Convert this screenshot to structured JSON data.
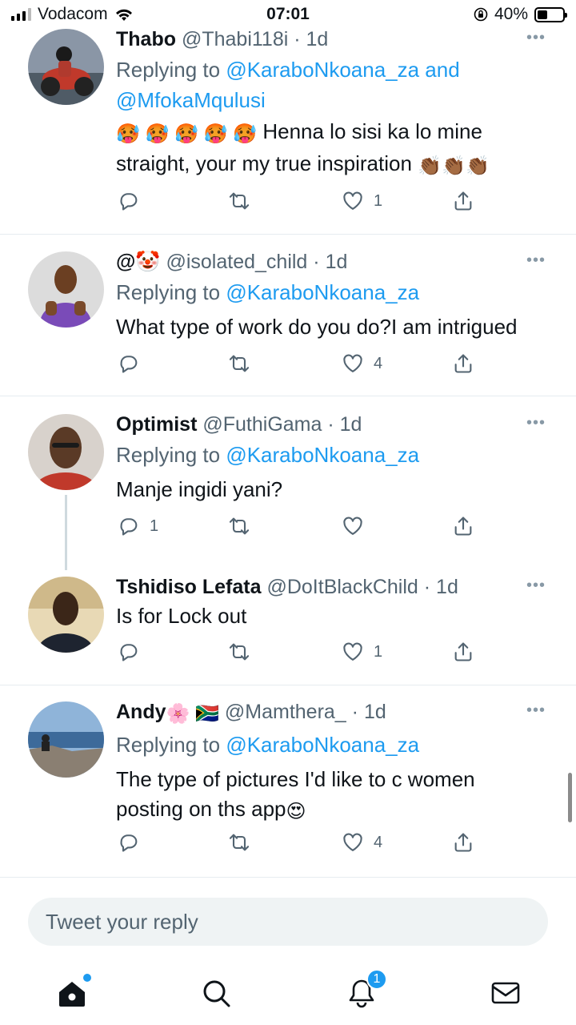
{
  "status_bar": {
    "carrier": "Vodacom",
    "time": "07:01",
    "battery": "40%"
  },
  "tweets": [
    {
      "name": "Thabo",
      "handle": "@Thabi118i",
      "time": "· 1d",
      "replying_prefix": "Replying to ",
      "replying_mentions": "@KaraboNkoana_za and",
      "replying_mentions_2": "@MfokaMqulusi",
      "text_1": "Henna lo sisi ka lo mine",
      "text_2": "straight, your my true inspiration",
      "emoji_prefix": "🥵 🥵 🥵 🥵 🥵",
      "emoji_suffix": "👏🏾👏🏾👏🏾",
      "replies": "",
      "retweets": "",
      "likes": "1"
    },
    {
      "name": "@🤡",
      "handle": "@isolated_child",
      "time": "· 1d",
      "replying_prefix": "Replying to ",
      "replying_mentions": "@KaraboNkoana_za",
      "text": "What type of work do you do?I am intrigued",
      "replies": "",
      "retweets": "",
      "likes": "4"
    },
    {
      "name": "Optimist",
      "handle": "@FuthiGama",
      "time": "· 1d",
      "replying_prefix": "Replying to ",
      "replying_mentions": "@KaraboNkoana_za",
      "text": "Manje ingidi yani?",
      "replies": "1",
      "retweets": "",
      "likes": ""
    },
    {
      "name": "Tshidiso Lefata",
      "handle": "@DoItBlackChild",
      "time": "· 1d",
      "text": "Is for Lock out",
      "replies": "",
      "retweets": "",
      "likes": "1"
    },
    {
      "name": "Andy",
      "name_emoji": "🌸 🇿🇦",
      "handle": "@Mamthera_",
      "time": "· 1d",
      "replying_prefix": "Replying to ",
      "replying_mentions": "@KaraboNkoana_za",
      "text_1": "The type of pictures I'd like to c women",
      "text_2": "posting on ths app",
      "text_emoji": "😍",
      "replies": "",
      "retweets": "",
      "likes": "4"
    }
  ],
  "reply_box": {
    "placeholder": "Tweet your reply"
  },
  "bottom_nav": {
    "notifications_badge": "1"
  },
  "colors": {
    "accent": "#1d9bf0",
    "secondary_text": "#536471"
  }
}
